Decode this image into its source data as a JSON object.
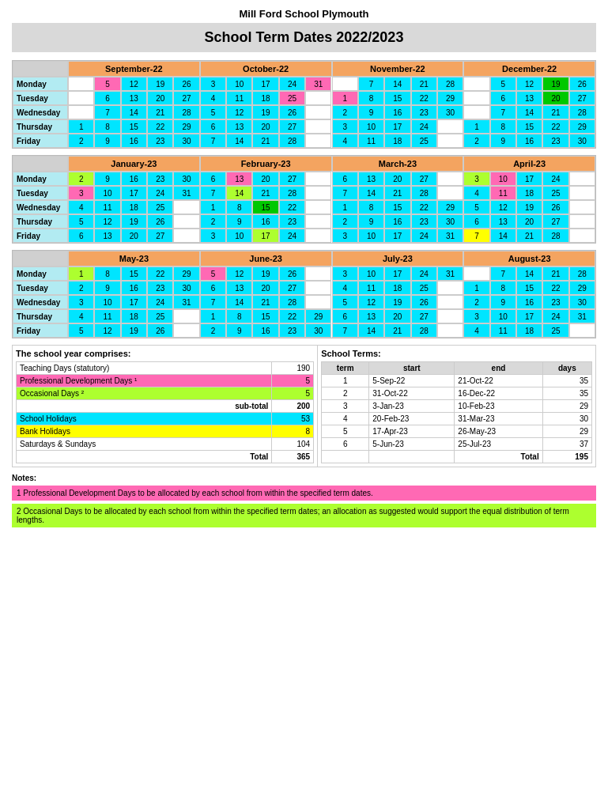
{
  "header": {
    "school_name": "Mill Ford School Plymouth",
    "title": "School Term Dates 2022/2023"
  },
  "months_row1": [
    {
      "name": "September-22",
      "days": [
        "Monday",
        "Tuesday",
        "Wednesday",
        "Thursday",
        "Friday"
      ],
      "weeks": [
        [
          "",
          "5",
          "12",
          "19",
          "26"
        ],
        [
          "",
          "6",
          "13",
          "20",
          "27"
        ],
        [
          "",
          "7",
          "14",
          "21",
          "28"
        ],
        [
          "1",
          "8",
          "15",
          "22",
          "29"
        ],
        [
          "2",
          "9",
          "16",
          "23",
          "30"
        ]
      ],
      "colors": {
        "5": "pink",
        "1": "cyan",
        "2": "cyan"
      }
    },
    {
      "name": "October-22",
      "weeks": [
        [
          "3",
          "10",
          "17",
          "24",
          "31"
        ],
        [
          "4",
          "11",
          "18",
          "25",
          ""
        ],
        [
          "5",
          "12",
          "19",
          "26",
          ""
        ],
        [
          "6",
          "13",
          "20",
          "27",
          ""
        ],
        [
          "7",
          "14",
          "21",
          "28",
          ""
        ]
      ],
      "colors": {
        "24": "cyan",
        "31": "pink",
        "25": "pink"
      }
    },
    {
      "name": "November-22",
      "weeks": [
        [
          "",
          "7",
          "14",
          "21",
          "28"
        ],
        [
          "1",
          "8",
          "15",
          "22",
          "29"
        ],
        [
          "2",
          "9",
          "16",
          "23",
          "30"
        ],
        [
          "3",
          "10",
          "17",
          "24",
          ""
        ],
        [
          "4",
          "11",
          "18",
          "25",
          ""
        ]
      ],
      "colors": {
        "1": "pink"
      }
    },
    {
      "name": "December-22",
      "weeks": [
        [
          "",
          "5",
          "12",
          "19",
          "26"
        ],
        [
          "",
          "6",
          "13",
          "20",
          "27"
        ],
        [
          "",
          "7",
          "14",
          "21",
          "28"
        ],
        [
          "1",
          "8",
          "15",
          "22",
          "29"
        ],
        [
          "2",
          "9",
          "16",
          "23",
          "30"
        ]
      ],
      "colors": {
        "19": "green",
        "26": "cyan",
        "20": "green",
        "27": "cyan",
        "21": "cyan",
        "28": "cyan",
        "22": "cyan",
        "29": "cyan",
        "23": "cyan",
        "30": "cyan"
      }
    }
  ],
  "summary": {
    "left_title": "The school year comprises:",
    "right_title": "School Terms:",
    "rows": [
      {
        "label": "Teaching Days (statutory)",
        "value": "190",
        "color": "white"
      },
      {
        "label": "Professional Development Days ¹",
        "value": "5",
        "color": "pink"
      },
      {
        "label": "Occasional Days ²",
        "value": "5",
        "color": "lime"
      },
      {
        "label": "sub-total",
        "value": "200",
        "color": "white",
        "bold": true
      },
      {
        "label": "School Holidays",
        "value": "53",
        "color": "cyan"
      },
      {
        "label": "Bank Holidays",
        "value": "8",
        "color": "yellow"
      },
      {
        "label": "Saturdays & Sundays",
        "value": "104",
        "color": "white"
      },
      {
        "label": "Total",
        "value": "365",
        "color": "white",
        "bold": true
      }
    ],
    "terms": [
      {
        "term": "1",
        "start": "5-Sep-22",
        "end": "21-Oct-22",
        "days": "35"
      },
      {
        "term": "2",
        "start": "31-Oct-22",
        "end": "16-Dec-22",
        "days": "35"
      },
      {
        "term": "3",
        "start": "3-Jan-23",
        "end": "10-Feb-23",
        "days": "29"
      },
      {
        "term": "4",
        "start": "20-Feb-23",
        "end": "31-Mar-23",
        "days": "30"
      },
      {
        "term": "5",
        "start": "17-Apr-23",
        "end": "26-May-23",
        "days": "29"
      },
      {
        "term": "6",
        "start": "5-Jun-23",
        "end": "25-Jul-23",
        "days": "37"
      },
      {
        "term": "Total",
        "start": "",
        "end": "Total",
        "days": "195"
      }
    ]
  },
  "notes": {
    "title": "Notes:",
    "note1": "1  Professional Development Days to be allocated by each school from within the specified term dates.",
    "note2": "2  Occasional Days to be allocated by each school from within the specified term dates; an allocation as suggested would support the equal distribution of term lengths."
  }
}
